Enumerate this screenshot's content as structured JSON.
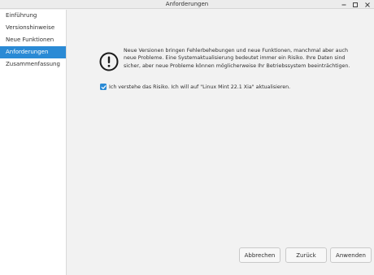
{
  "window": {
    "title": "Anforderungen"
  },
  "sidebar": {
    "items": [
      {
        "label": "Einführung",
        "active": false
      },
      {
        "label": "Versionshinweise",
        "active": false
      },
      {
        "label": "Neue Funktionen",
        "active": false
      },
      {
        "label": "Anforderungen",
        "active": true
      },
      {
        "label": "Zusammenfassung",
        "active": false
      }
    ]
  },
  "main": {
    "warning_icon": "exclamation-circle-icon",
    "warning_text": "Neue Versionen bringen Fehlerbehebungen und neue Funktionen, manchmal aber auch neue Probleme. Eine Systemaktualisierung bedeutet immer ein Risiko. Ihre Daten sind sicher, aber neue Probleme können möglicherweise Ihr Betriebssystem beeinträchtigen.",
    "acknowledge_label": "Ich verstehe das Risiko. Ich will auf \"Linux Mint 22.1 Xia\" aktualisieren.",
    "acknowledge_checked": true
  },
  "buttons": {
    "cancel": "Abbrechen",
    "back": "Zurück",
    "apply": "Anwenden"
  },
  "colors": {
    "accent": "#2a8ad5",
    "background": "#f2f2f2",
    "sidebar": "#ffffff"
  }
}
